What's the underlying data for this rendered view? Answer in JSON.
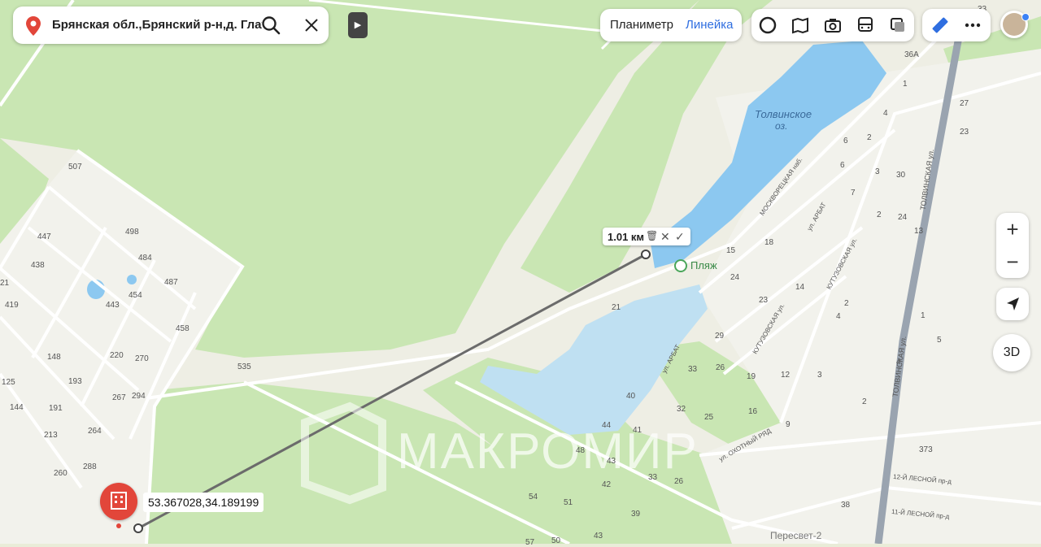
{
  "search": {
    "query": "Брянская обл.,Брянский р-н,д. Глаже"
  },
  "tools": {
    "planimeter": "Планиметр",
    "ruler": "Линейка"
  },
  "layer_icons": [
    "traffic-icon",
    "panorama-icon",
    "camera-icon",
    "transit-icon",
    "layers-icon"
  ],
  "measurement": {
    "distance": "1.01 км"
  },
  "marker": {
    "coordinates": "53.367028,34.189199"
  },
  "controls": {
    "zoom_in": "+",
    "zoom_out": "−",
    "view_3d": "3D"
  },
  "watermark": "МАКРОМИР",
  "places": {
    "lake_name": "Толвинское",
    "lake_sub": "оз.",
    "beach": "Пляж",
    "district": "Пересвет-2"
  },
  "streets": [
    "МОСКВОРЕЦКАЯ наб.",
    "ул. АРБАТ",
    "КУТУЗОВСКАЯ ул.",
    "КУТУЗОВСКАЯ ул.",
    "ТОЛВИНСКАЯ ул.",
    "ТОЛВИНСКАЯ ул.",
    "ул. АРБАТ",
    "ул. ОХОТНЫЙ РЯД",
    "12-Й ЛЕСНОЙ пр-д",
    "11-Й ЛЕСНОЙ пр-д"
  ],
  "house_numbers": [
    "507",
    "498",
    "484",
    "487",
    "447",
    "438",
    "454",
    "443",
    "419",
    "458",
    "21",
    "148",
    "220",
    "270",
    "193",
    "267",
    "294",
    "125",
    "144",
    "191",
    "213",
    "264",
    "288",
    "260",
    "535",
    "36А",
    "33",
    "1",
    "4",
    "27",
    "23",
    "6",
    "2",
    "30",
    "6",
    "3",
    "7",
    "18",
    "24",
    "2",
    "13",
    "15",
    "14",
    "24",
    "4",
    "23",
    "2",
    "1",
    "21",
    "29",
    "4",
    "5",
    "33",
    "26",
    "19",
    "12",
    "3",
    "40",
    "32",
    "16",
    "25",
    "44",
    "41",
    "9",
    "48",
    "43",
    "42",
    "33",
    "26",
    "54",
    "51",
    "39",
    "373",
    "38",
    "2",
    "57",
    "50",
    "43"
  ],
  "colors": {
    "forest": "#c8e6b4",
    "field": "#e9ecd8",
    "water": "#8cc8f0",
    "water_light": "#bfe0f2",
    "accent": "#2f6ee0",
    "marker": "#e2463a"
  }
}
